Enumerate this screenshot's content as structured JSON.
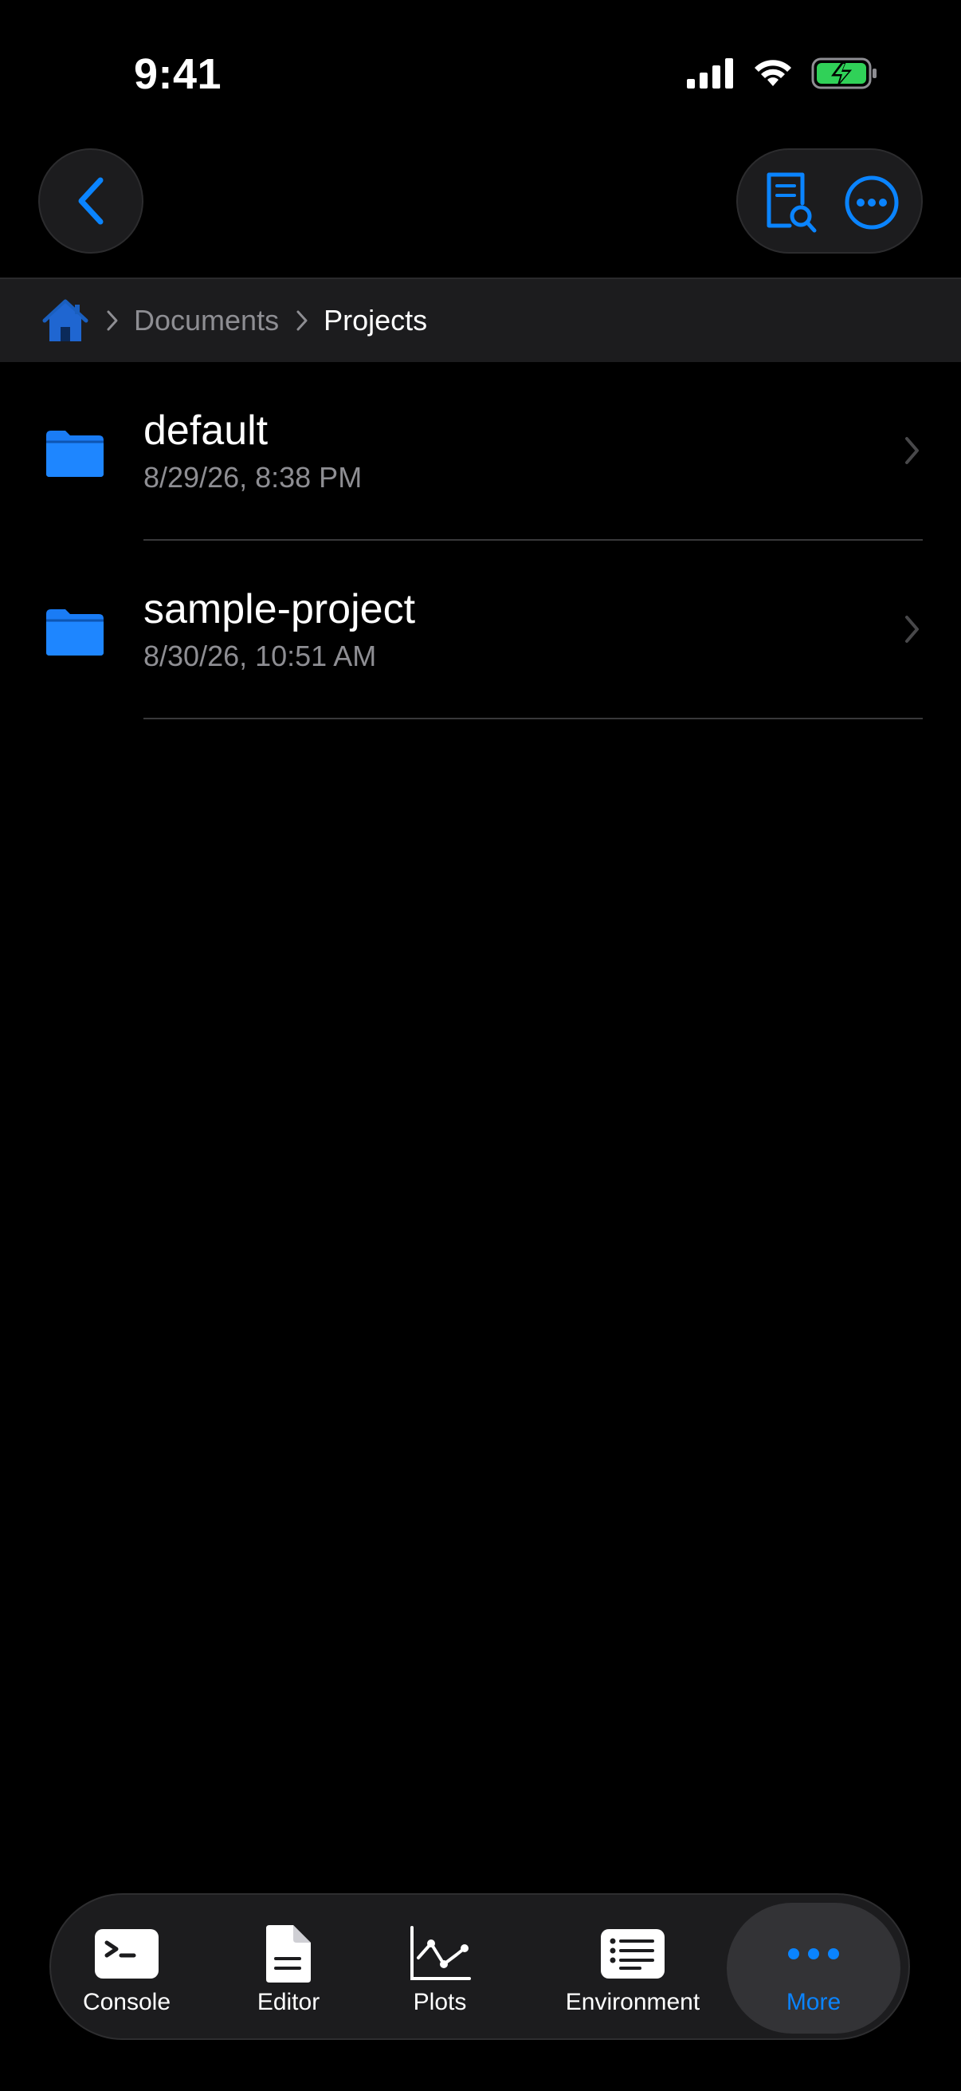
{
  "status_bar": {
    "time": "9:41"
  },
  "nav": {
    "back_icon": "chevron-left-icon",
    "preview_icon": "document-search-icon",
    "more_icon": "ellipsis-circle-icon",
    "accent_color": "#0a84ff"
  },
  "breadcrumb": {
    "home_icon": "house-icon",
    "items": [
      {
        "label": "Documents"
      },
      {
        "label": "Projects"
      }
    ]
  },
  "files": [
    {
      "name": "default",
      "date": "8/29/26, 8:38 PM",
      "icon": "folder-icon"
    },
    {
      "name": "sample-project",
      "date": "8/30/26, 10:51 AM",
      "icon": "folder-icon"
    }
  ],
  "tab_bar": {
    "tabs": [
      {
        "label": "Console",
        "icon": "terminal-icon"
      },
      {
        "label": "Editor",
        "icon": "document-icon"
      },
      {
        "label": "Plots",
        "icon": "line-chart-icon"
      },
      {
        "label": "Environment",
        "icon": "list-icon"
      },
      {
        "label": "More",
        "icon": "ellipsis-icon"
      }
    ],
    "selected": "More",
    "active_color": "#0a84ff"
  }
}
